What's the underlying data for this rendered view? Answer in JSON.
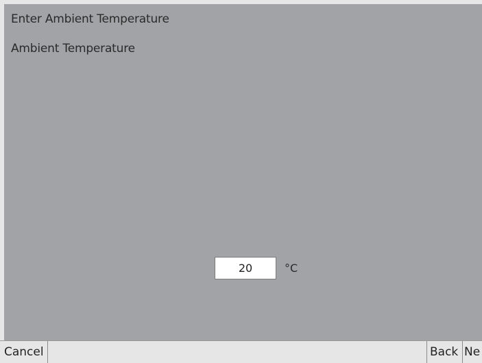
{
  "header": {
    "title": "Enter Ambient Temperature"
  },
  "form": {
    "label": "Ambient Temperature",
    "value": "20",
    "unit": "°C"
  },
  "bottom_bar": {
    "cancel_label": "Cancel",
    "back_label": "Back",
    "next_label": "Ne"
  },
  "colors": {
    "panel_background": "#a2a3a6",
    "bar_background": "#e6e6e6",
    "input_background": "#ffffff"
  }
}
